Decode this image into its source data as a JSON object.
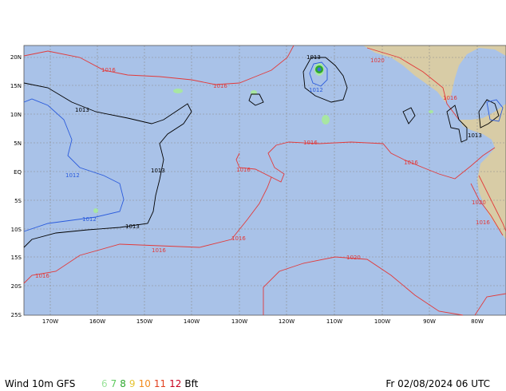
{
  "map": {
    "lat_labels": [
      "20N",
      "15N",
      "10N",
      "5N",
      "EQ",
      "5S",
      "10S",
      "15S",
      "20S",
      "25S"
    ],
    "lon_labels": [
      "170W",
      "160W",
      "150W",
      "140W",
      "130W",
      "120W",
      "110W",
      "100W",
      "90W",
      "80W"
    ],
    "isobar_labels": [
      "1013",
      "1013",
      "1013",
      "1013",
      "1013",
      "1012",
      "1012",
      "1012",
      "1016",
      "1016",
      "1016",
      "1016",
      "1016",
      "1016",
      "1016",
      "1016",
      "1016",
      "1020",
      "1020",
      "1020",
      "1016"
    ],
    "colors": {
      "ocean": "#a9c2e8",
      "land": "#d8cca6",
      "grid": "#8c8c8c",
      "isobar_high": "#e23a3a",
      "isobar_mid": "#000000",
      "isobar_low": "#2a5bdc",
      "wind_light": "#a8e6a2"
    }
  },
  "footer": {
    "title": "Wind 10m GFS",
    "scale_values": [
      "6",
      "7",
      "8",
      "9",
      "10",
      "11",
      "12"
    ],
    "scale_colors": [
      "#9be39b",
      "#5ecb5e",
      "#2ea82e",
      "#e6c433",
      "#f28c1e",
      "#e2401e",
      "#c8001e"
    ],
    "unit": "Bft",
    "date": "Fr 02/08/2024 06 UTC"
  }
}
